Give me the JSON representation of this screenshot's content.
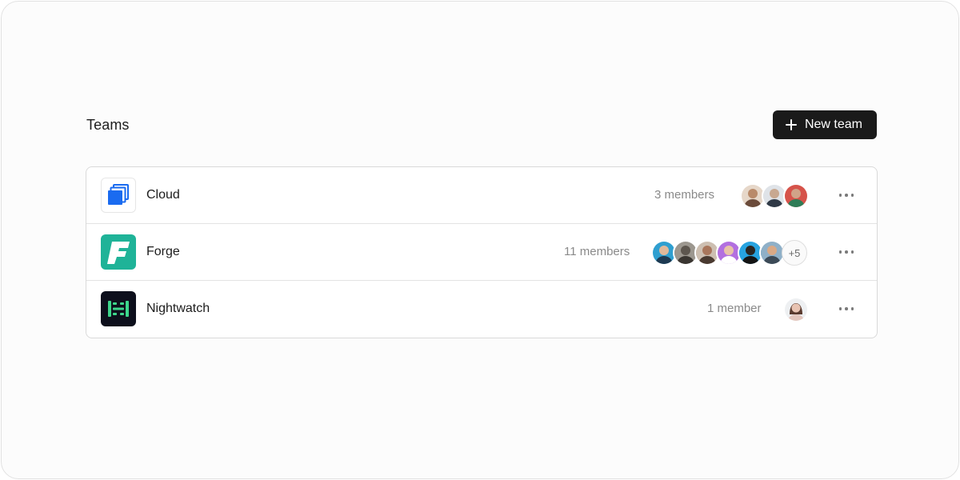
{
  "header": {
    "title": "Teams",
    "new_team_label": "New team"
  },
  "teams": [
    {
      "name": "Cloud",
      "logo": "cloud-stack-icon",
      "members_label": "3 members",
      "avatars": [
        {
          "label": "member avatar",
          "color": "#b98a6a"
        },
        {
          "label": "member avatar",
          "color": "#9aa3ad"
        },
        {
          "label": "member avatar",
          "color": "#d6534a"
        }
      ],
      "overflow": ""
    },
    {
      "name": "Forge",
      "logo": "forge-f-icon",
      "members_label": "11 members",
      "avatars": [
        {
          "label": "member avatar",
          "color": "#2f9fd0"
        },
        {
          "label": "member avatar",
          "color": "#6f6b64"
        },
        {
          "label": "member avatar",
          "color": "#a9765b"
        },
        {
          "label": "member avatar",
          "color": "#b26fe0"
        },
        {
          "label": "member avatar",
          "color": "#27a3e0"
        },
        {
          "label": "member avatar",
          "color": "#8fb0c8"
        }
      ],
      "overflow": "+5"
    },
    {
      "name": "Nightwatch",
      "logo": "nightwatch-icon",
      "members_label": "1 member",
      "avatars": [
        {
          "label": "member avatar",
          "color": "#e3c6bd"
        }
      ],
      "overflow": ""
    }
  ],
  "colors": {
    "button_bg": "#1a1a1a",
    "forge_brand": "#1fb398",
    "nightwatch_brand": "#0d0f1c",
    "nightwatch_accent": "#3dd68c",
    "cloud_brand": "#1a6bf0"
  }
}
